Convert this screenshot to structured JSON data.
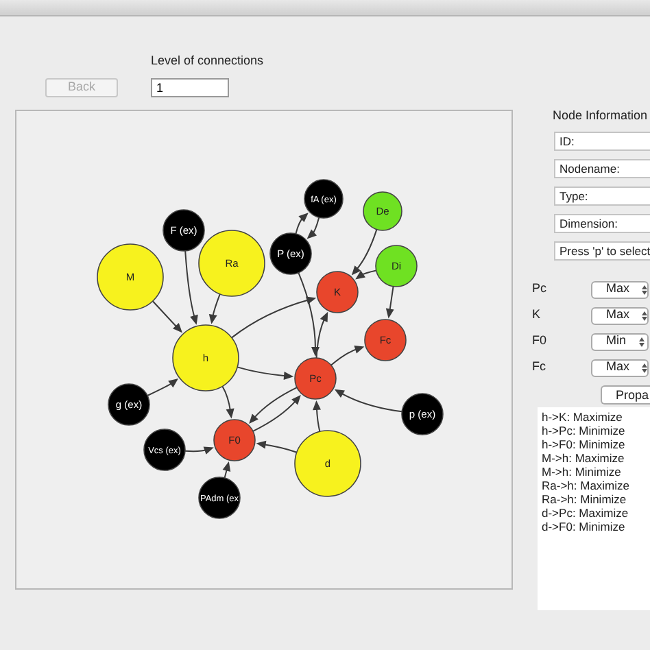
{
  "toolbar": {
    "back_button": {
      "label": "Back",
      "disabled": true
    },
    "level_label": "Level of connections",
    "level_value": "1"
  },
  "graph": {
    "nodes": [
      {
        "label": "M",
        "color": "#f7f21e"
      },
      {
        "label": "F (ex)",
        "color": "#000000"
      },
      {
        "label": "Ra",
        "color": "#f7f21e"
      },
      {
        "label": "h",
        "color": "#f7f21e"
      },
      {
        "label": "fA (ex)",
        "color": "#000000"
      },
      {
        "label": "P (ex)",
        "color": "#000000"
      },
      {
        "label": "De",
        "color": "#6fe122"
      },
      {
        "label": "Di",
        "color": "#6fe122"
      },
      {
        "label": "K",
        "color": "#e8462c"
      },
      {
        "label": "Fc",
        "color": "#e8462c"
      },
      {
        "label": "Pc",
        "color": "#e8462c"
      },
      {
        "label": "g (ex)",
        "color": "#000000"
      },
      {
        "label": "p (ex)",
        "color": "#000000"
      },
      {
        "label": "Vcs (ex)",
        "color": "#000000"
      },
      {
        "label": "F0",
        "color": "#e8462c"
      },
      {
        "label": "d",
        "color": "#f7f21e"
      },
      {
        "label": "PAdm (ex",
        "color": "#000000"
      }
    ]
  },
  "node_information": {
    "title": "Node Information",
    "fields": [
      "ID:",
      "Nodename:",
      "Type:",
      "Dimension:",
      "Press 'p' to select"
    ],
    "goals": [
      {
        "label": "Pc",
        "value": "Max"
      },
      {
        "label": "K",
        "value": "Max"
      },
      {
        "label": "F0",
        "value": "Min"
      },
      {
        "label": "Fc",
        "value": "Max"
      }
    ],
    "propagate_button": "Propa",
    "results": [
      "h->K: Maximize",
      "h->Pc: Minimize",
      "h->F0: Minimize",
      "M->h: Maximize",
      "M->h: Minimize",
      "Ra->h: Maximize",
      "Ra->h: Minimize",
      "d->Pc: Maximize",
      "d->F0: Minimize"
    ]
  }
}
